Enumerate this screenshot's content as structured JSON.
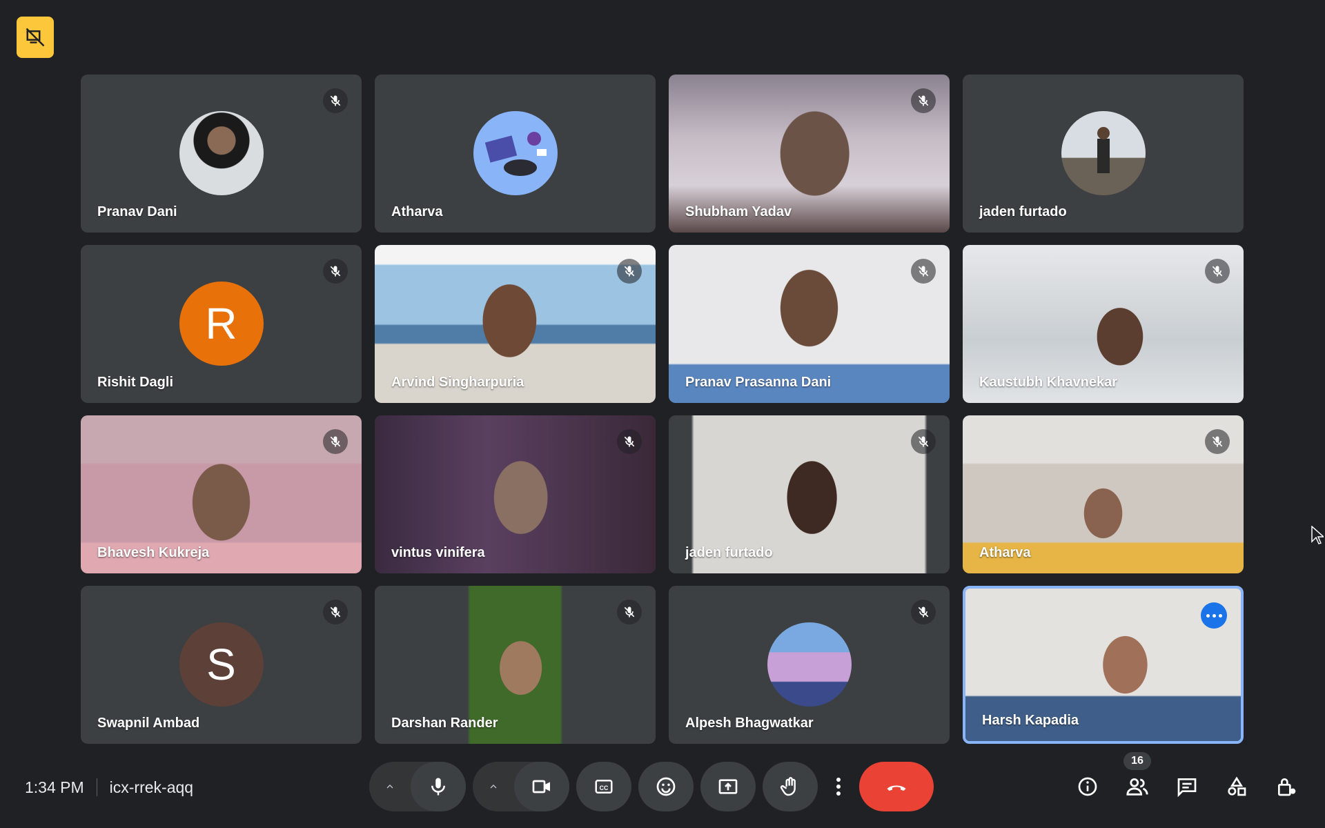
{
  "participants": [
    {
      "name": "Pranav Dani",
      "muted": true,
      "kind": "photo-avatar"
    },
    {
      "name": "Atharva",
      "muted": false,
      "kind": "illustration-avatar"
    },
    {
      "name": "Shubham Yadav",
      "muted": true,
      "kind": "video"
    },
    {
      "name": "jaden furtado",
      "muted": false,
      "kind": "photo-avatar"
    },
    {
      "name": "Rishit Dagli",
      "muted": true,
      "kind": "letter-avatar",
      "initial": "R",
      "color": "#e8710a"
    },
    {
      "name": "Arvind Singharpuria",
      "muted": true,
      "kind": "video"
    },
    {
      "name": "Pranav Prasanna Dani",
      "muted": true,
      "kind": "video"
    },
    {
      "name": "Kaustubh Khavnekar",
      "muted": true,
      "kind": "video"
    },
    {
      "name": "Bhavesh Kukreja",
      "muted": true,
      "kind": "video"
    },
    {
      "name": "vintus vinifera",
      "muted": true,
      "kind": "video"
    },
    {
      "name": "jaden furtado",
      "muted": true,
      "kind": "video"
    },
    {
      "name": "Atharva",
      "muted": true,
      "kind": "video"
    },
    {
      "name": "Swapnil Ambad",
      "muted": true,
      "kind": "letter-avatar",
      "initial": "S",
      "color": "#5d4037"
    },
    {
      "name": "Darshan Rander",
      "muted": true,
      "kind": "video"
    },
    {
      "name": "Alpesh Bhagwatkar",
      "muted": true,
      "kind": "illustration-avatar"
    },
    {
      "name": "Harsh Kapadia",
      "muted": false,
      "kind": "video",
      "self": true
    }
  ],
  "meeting": {
    "time": "1:34 PM",
    "code": "icx-rrek-aqq"
  },
  "people_count": "16",
  "colors": {
    "background": "#202124",
    "tile": "#3c4043",
    "end_call": "#ea4335",
    "accent": "#8ab4f8",
    "badge": "#fdc73b"
  }
}
